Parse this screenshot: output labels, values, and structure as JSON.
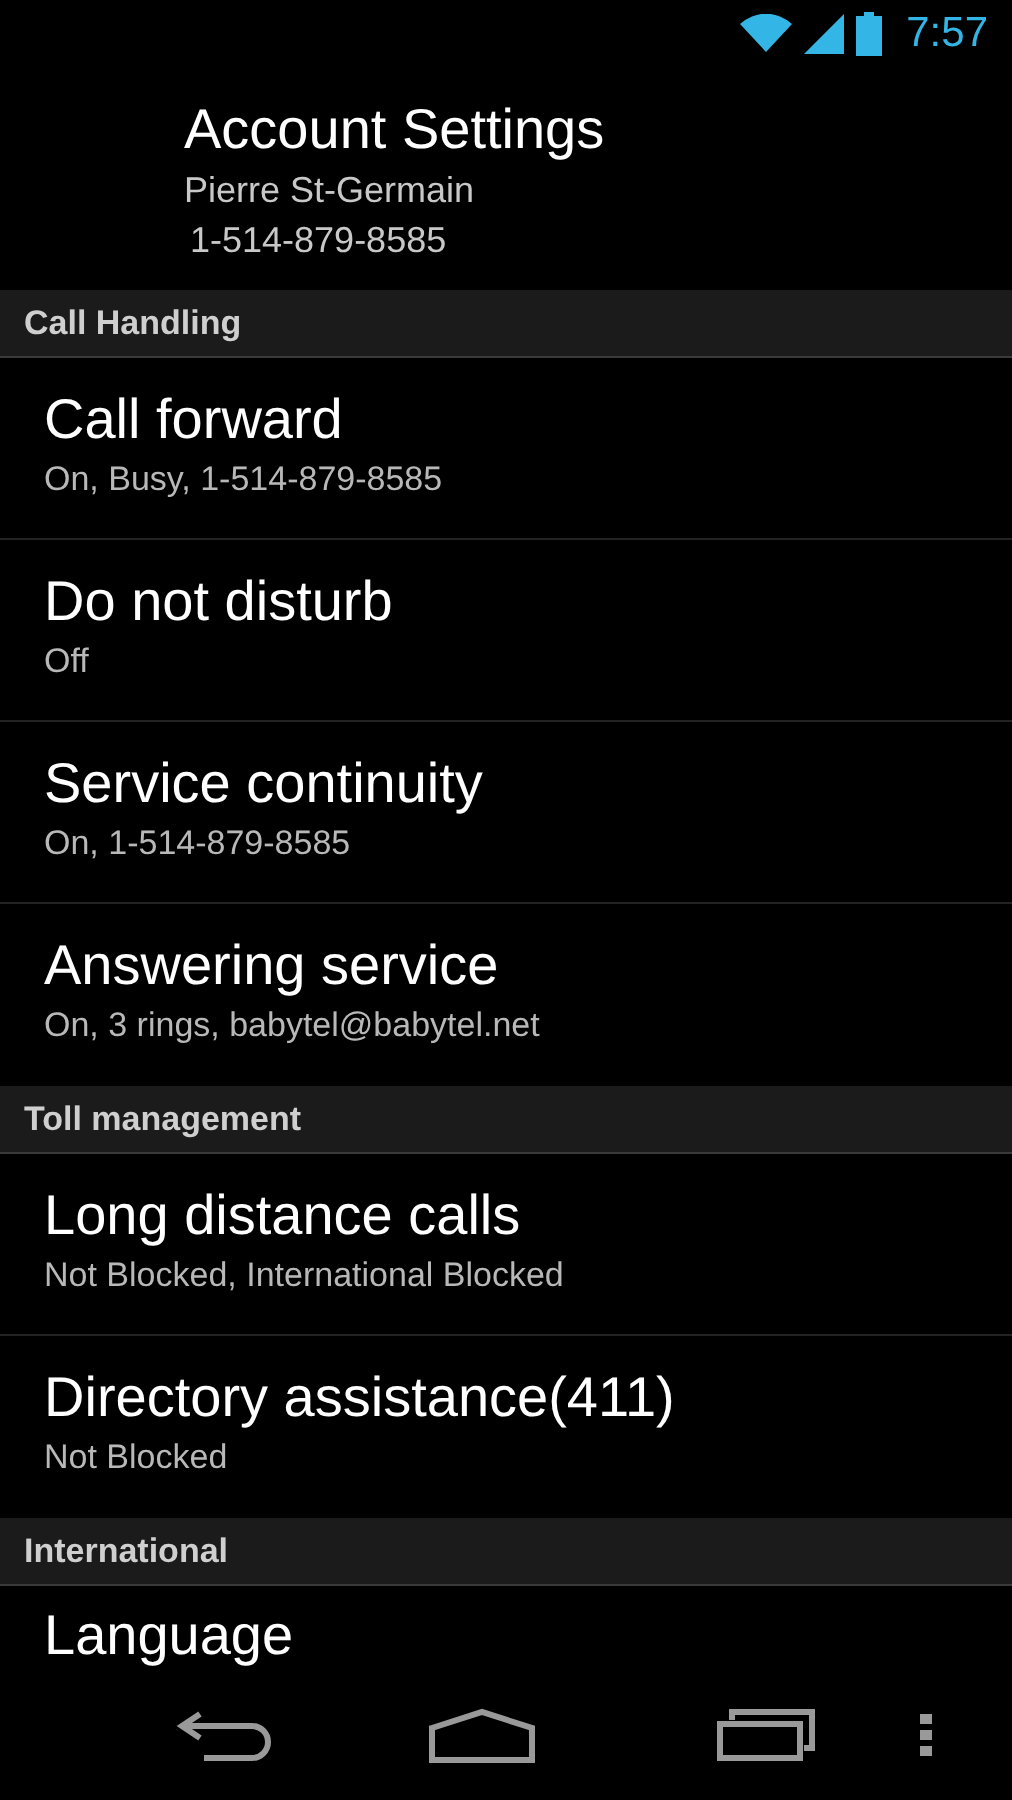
{
  "status_bar": {
    "time": "7:57"
  },
  "header": {
    "title": "Account Settings",
    "name": "Pierre St-Germain",
    "phone": "1-514-879-8585"
  },
  "sections": [
    {
      "title": "Call Handling",
      "items": [
        {
          "title": "Call forward",
          "summary": "On, Busy, 1-514-879-8585"
        },
        {
          "title": "Do not disturb",
          "summary": "Off"
        },
        {
          "title": "Service continuity",
          "summary": "On, 1-514-879-8585"
        },
        {
          "title": "Answering service",
          "summary": "On, 3 rings, babytel@babytel.net"
        }
      ]
    },
    {
      "title": "Toll management",
      "items": [
        {
          "title": "Long distance calls",
          "summary": "Not Blocked, International Blocked"
        },
        {
          "title": "Directory assistance(411)",
          "summary": "Not Blocked"
        }
      ]
    },
    {
      "title": "International",
      "items": [
        {
          "title": "Language"
        }
      ]
    }
  ]
}
